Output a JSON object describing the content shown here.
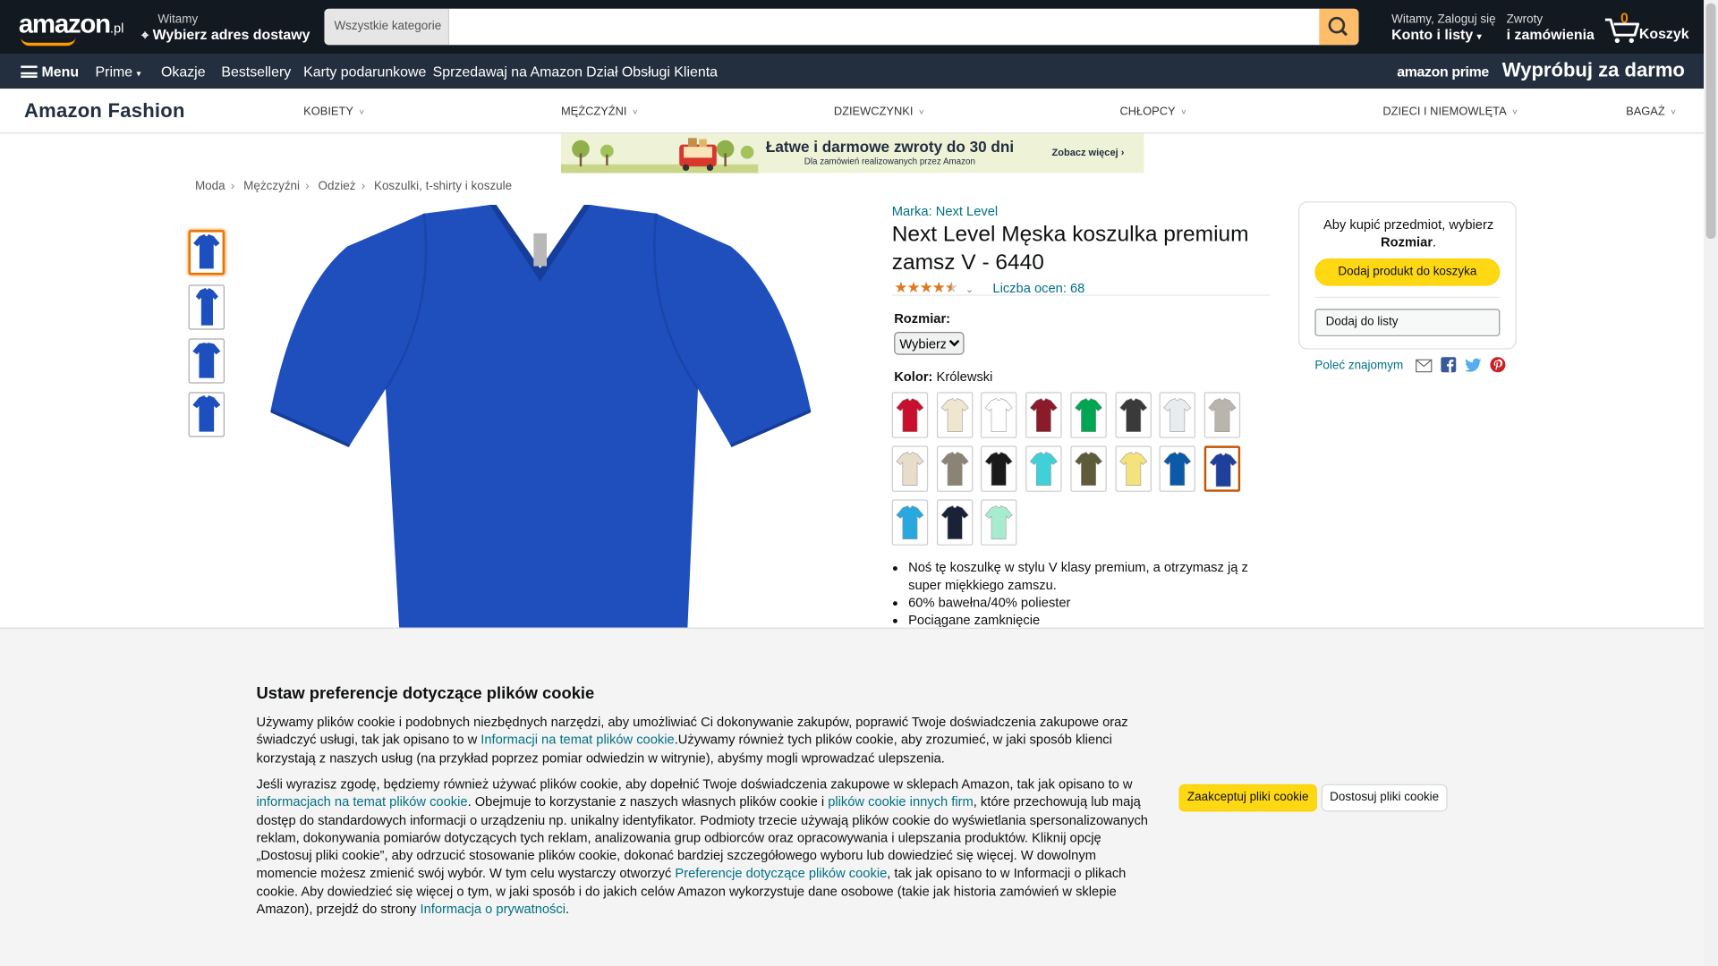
{
  "header": {
    "logo_text": "amazon",
    "logo_suffix": ".pl",
    "deliver_line1": "Witamy",
    "deliver_line2": "Wybierz adres dostawy",
    "search_category": "Wszystkie kategorie",
    "search_placeholder": "",
    "account_line1": "Witamy, Zaloguj się",
    "account_line2": "Konto i listy",
    "returns_line1": "Zwroty",
    "returns_line2": "i zamówienia",
    "cart_count": "0",
    "cart_label": "Koszyk"
  },
  "nav_main": {
    "menu": "Menu",
    "items": [
      "Prime",
      "Okazje",
      "Bestsellery",
      "Karty podarunkowe",
      "Sprzedawaj na Amazon",
      "Dział Obsługi Klienta"
    ],
    "prime_logo": "amazon prime",
    "prime_cta": "Wypróbuj za darmo"
  },
  "fashion_nav": {
    "logo": "Amazon Fashion",
    "items": [
      "KOBIETY",
      "MĘŻCZYŹNI",
      "DZIEWCZYNKI",
      "CHŁOPCY",
      "DZIECI I NIEMOWLĘTA",
      "BAGAŻ"
    ]
  },
  "banner": {
    "text": "Łatwe i darmowe zwroty do 30 dni",
    "subtext": "Dla zamówień realizowanych przez Amazon",
    "cta": "Zobacz więcej ›"
  },
  "breadcrumb": [
    "Moda",
    "Mężczyźni",
    "Odzież",
    "Koszulki, t-shirty i koszule"
  ],
  "product": {
    "brand": "Marka: Next Level",
    "title": "Next Level Męska koszulka premium zamsz V - 6440",
    "stars": "4.5",
    "ratings_count": "Liczba ocen: 68",
    "size_label": "Rozmiar:",
    "size_value": "Wybierz",
    "color_label": "Kolor:",
    "color_value": "Królewski",
    "color_swatches": [
      "#c8102e",
      "#efe6cf",
      "#ffffff",
      "#8b1a2b",
      "#00a651",
      "#3a3a3a",
      "#e8ecef",
      "#b9b4ac",
      "#e8dccb",
      "#8b8475",
      "#1a1a1a",
      "#40d0d8",
      "#5e5b3b",
      "#f4e27c",
      "#0b5aa8",
      "#1e3f9c",
      "#29a8e0",
      "#1a2238",
      "#a8ecd0"
    ],
    "selected_swatch": 15,
    "bullets": [
      "Noś tę koszulkę w stylu V klasy premium, a otrzymasz ją z super miękkiego zamszu.",
      "60% bawełna/40% poliester",
      "Pociągane zamknięcie"
    ]
  },
  "buybox": {
    "text_pre": "Aby kupić przedmiot, wybierz",
    "text_bold": "Rozmiar",
    "text_post": ".",
    "add_to_cart": "Dodaj produkt do koszyka",
    "add_to_list": "Dodaj do listy",
    "share_label": "Poleć znajomym"
  },
  "cookie": {
    "title": "Ustaw preferencje dotyczące plików cookie",
    "p1_a": "Używamy plików cookie i podobnych niezbędnych narzędzi, aby umożliwiać Ci dokonywanie zakupów, poprawić Twoje doświadczenia zakupowe oraz świadczyć usługi, tak jak opisano to w ",
    "p1_link": "Informacji na temat plików cookie",
    "p1_b": ".Używamy również tych plików cookie, aby zrozumieć, w jaki sposób klienci korzystają z naszych usług (na przykład poprzez pomiar odwiedzin w witrynie), abyśmy mogli wprowadzać ulepszenia.",
    "p2_a": "Jeśli wyrazisz zgodę, będziemy również używać plików cookie, aby dopełnić Twoje doświadczenia zakupowe w sklepach Amazon, tak jak opisano to w ",
    "p2_link1": "informacjach na temat plików cookie",
    "p2_b": ". Obejmuje to korzystanie z naszych własnych plików cookie i ",
    "p2_link2": "plików cookie innych firm",
    "p2_c": ", które przechowują lub mają dostęp do standardowych informacji o urządzeniu np. unikalny identyfikator. Podmioty trzecie używają plików cookie do wyświetlania spersonalizowanych reklam, dokonywania pomiarów dotyczących tych reklam, analizowania grup odbiorców oraz opracowywania i ulepszania produktów. Kliknij opcję „Dostosuj pliki cookie”, aby odrzucić stosowanie plików cookie, dokonać bardziej szczegółowego wyboru lub dowiedzieć się więcej. W dowolnym momencie możesz zmienić swój wybór. W tym celu wystarczy otworzyć ",
    "p2_link3": "Preferencje dotyczące plików cookie",
    "p2_d": ", tak jak opisano to w Informacji o plikach cookie. Aby dowiedzieć się więcej o tym, w jaki sposób i do jakich celów Amazon wykorzystuje dane osobowe (takie jak historia zamówień w sklepie Amazon), przejdź do strony ",
    "p2_link4": "Informacja o prywatności",
    "p2_e": ".",
    "accept": "Zaakceptuj pliki cookie",
    "customize": "Dostosuj pliki cookie"
  }
}
